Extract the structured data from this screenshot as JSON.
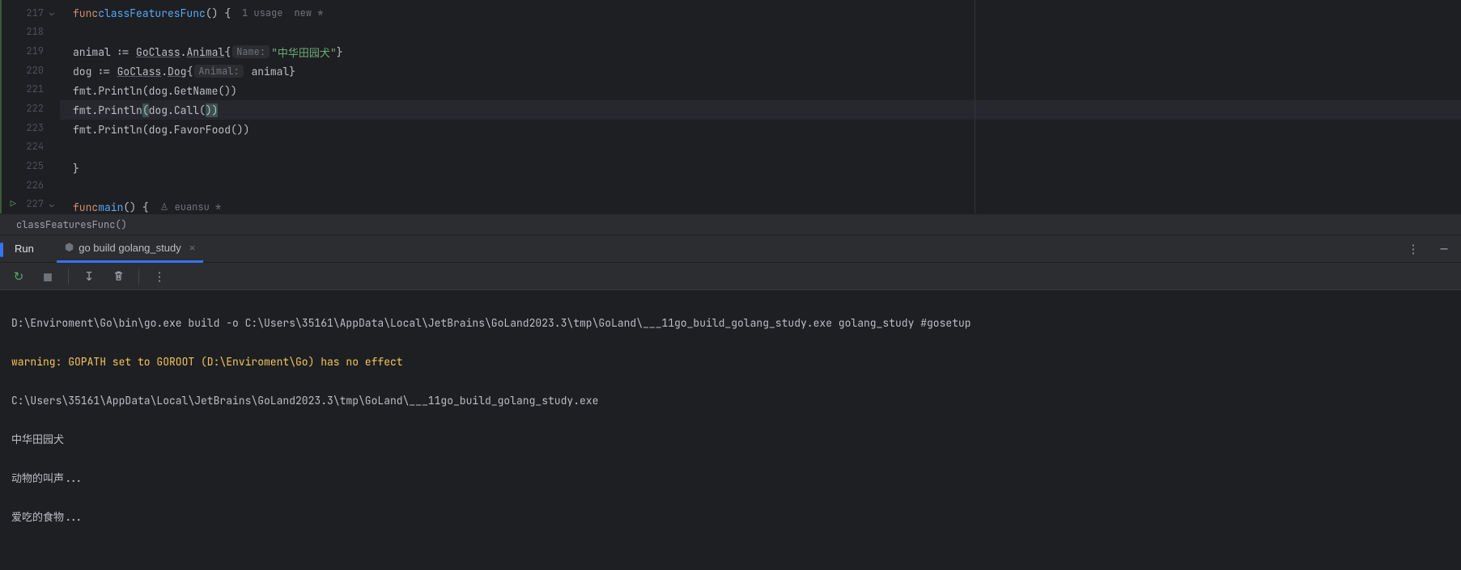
{
  "editor": {
    "lines": [
      "217",
      "218",
      "219",
      "220",
      "221",
      "222",
      "223",
      "224",
      "225",
      "226",
      "227"
    ],
    "func_kw": "func",
    "fn1_name": "classFeaturesFunc",
    "fn1_paren_brace": "() {",
    "usage_hint": "1 usage",
    "new_hint": "new *",
    "l219_lhs": "animal := ",
    "l219_pkg": "GoClass",
    "l219_dot": ".",
    "l219_type": "Animal",
    "l219_brace_open": "{",
    "l219_hint": "Name:",
    "l219_str": "\"中华田园犬\"",
    "l219_brace_close": "}",
    "l220_lhs": "dog := ",
    "l220_type": "Dog",
    "l220_brace_open": "{",
    "l220_hint": "Animal:",
    "l220_val": " animal}",
    "l221": "fmt.Println(dog.GetName())",
    "l222_a": "fmt.Println",
    "l222_b": "(",
    "l222_c": "dog.Call(",
    "l222_d": ")",
    "l222_e": ")",
    "l223": "fmt.Println(dog.FavorFood())",
    "l225_close": "}",
    "fn2_name": "main",
    "fn2_paren_brace": "() {",
    "author_hint": "euansu *"
  },
  "breadcrumb": "classFeaturesFunc()",
  "toolWindow": {
    "title": "Run",
    "tab_label": "go build golang_study"
  },
  "console": {
    "l1": "D:\\Enviroment\\Go\\bin\\go.exe build -o C:\\Users\\35161\\AppData\\Local\\JetBrains\\GoLand2023.3\\tmp\\GoLand\\___11go_build_golang_study.exe golang_study #gosetup",
    "l2": "warning: GOPATH set to GOROOT (D:\\Enviroment\\Go) has no effect",
    "l3": "C:\\Users\\35161\\AppData\\Local\\JetBrains\\GoLand2023.3\\tmp\\GoLand\\___11go_build_golang_study.exe",
    "l4": "中华田园犬",
    "l5": "动物的叫声...",
    "l6": "爱吃的食物..."
  }
}
